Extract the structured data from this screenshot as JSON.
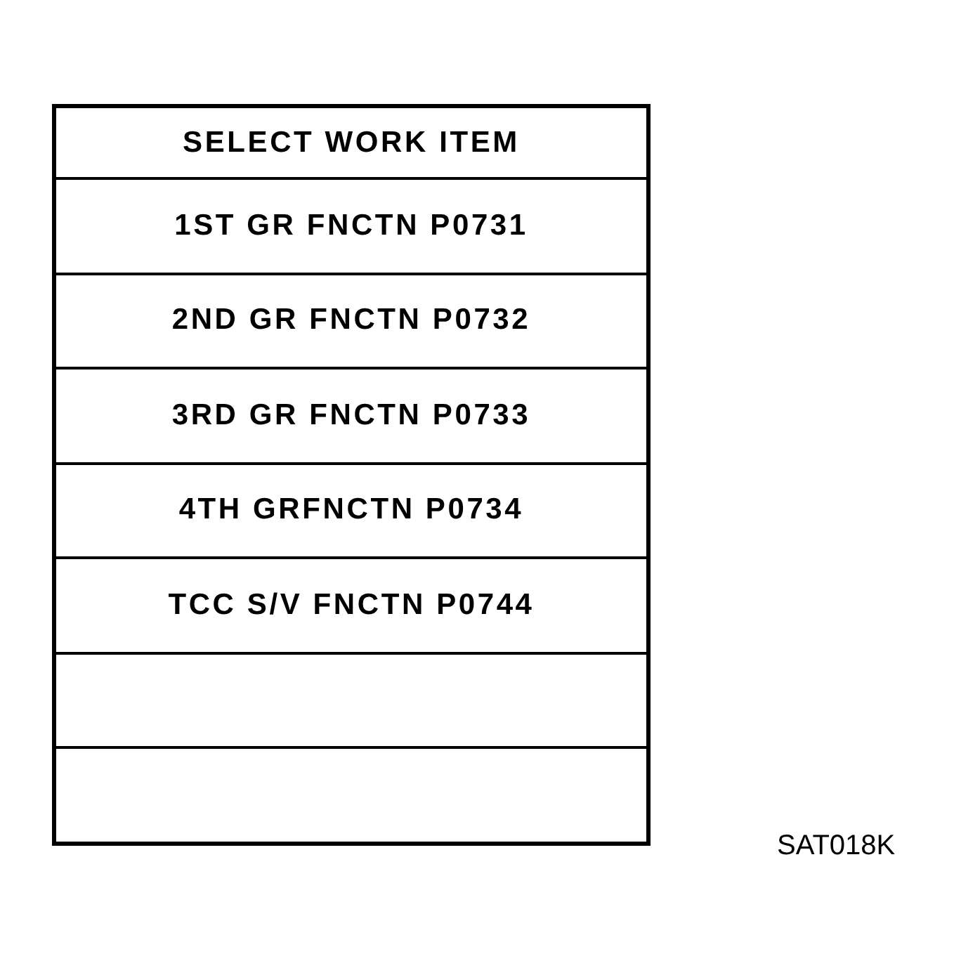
{
  "table": {
    "title": "SELECT WORK ITEM",
    "rows": [
      {
        "kind": "item",
        "label": "1ST GR FNCTN P0731"
      },
      {
        "kind": "item",
        "label": "2ND GR FNCTN P0732"
      },
      {
        "kind": "item",
        "label": "3RD GR FNCTN P0733"
      },
      {
        "kind": "item",
        "label": "4TH GRFNCTN P0734"
      },
      {
        "kind": "item",
        "label": "TCC S/V FNCTN P0744"
      },
      {
        "kind": "blank"
      },
      {
        "kind": "blank"
      }
    ]
  },
  "figure_code": "SAT018K"
}
